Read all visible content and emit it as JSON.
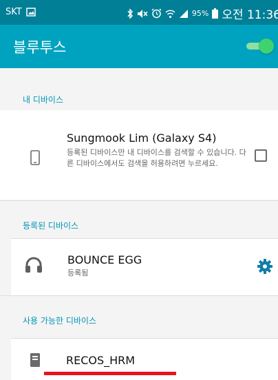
{
  "status_bar": {
    "carrier": "SKT",
    "battery_percent": "95%",
    "time": "오전 11:36"
  },
  "app_bar": {
    "title": "블루투스",
    "bluetooth_enabled": true
  },
  "my_device": {
    "section_title": "내 디바이스",
    "name": "Sungmook Lim (Galaxy S4)",
    "description": "등록된 디바이스만 내 디바이스를 검색할 수 있습니다. 다른 디바이스에서도 검색을 허용하려면 누르세요.",
    "visible_checked": false
  },
  "paired_devices": {
    "section_title": "등록된 디바이스",
    "items": [
      {
        "name": "BOUNCE EGG",
        "status": "등록됨",
        "icon": "headphones-icon"
      }
    ]
  },
  "available_devices": {
    "section_title": "사용 가능한 디바이스",
    "items": [
      {
        "name": "RECOS_HRM",
        "icon": "device-icon"
      }
    ]
  },
  "colors": {
    "status_bar": "#007f96",
    "app_bar": "#00a3bf",
    "accent": "#0096b4",
    "toggle_on": "#3fd26e",
    "highlight": "#e8141c"
  }
}
